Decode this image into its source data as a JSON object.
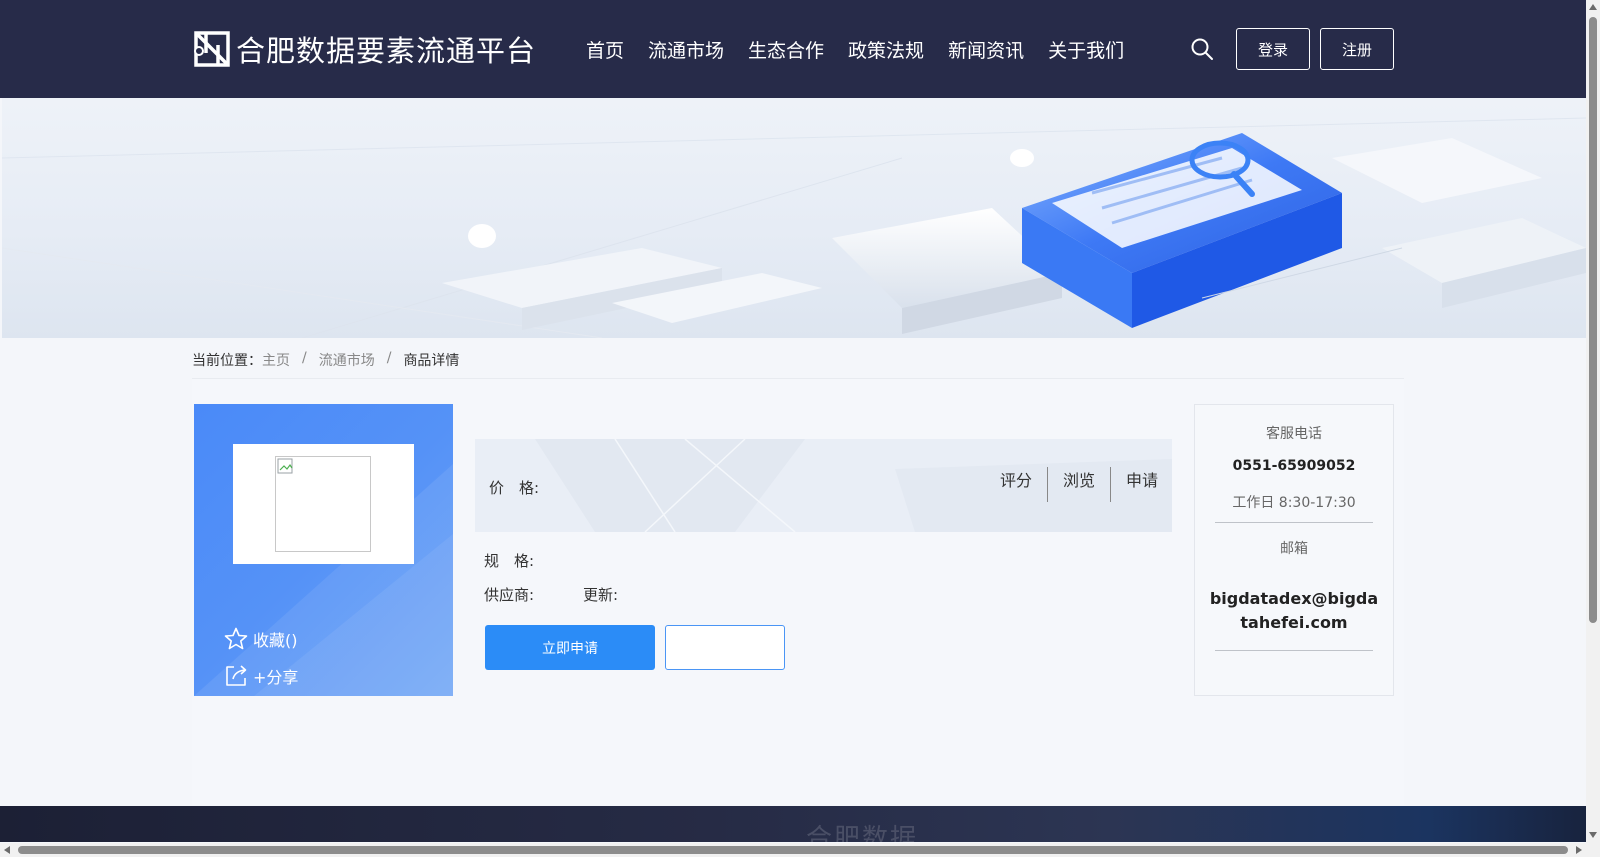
{
  "header": {
    "logo_text": "合肥数据要素流通平台",
    "nav": [
      "首页",
      "流通市场",
      "生态合作",
      "政策法规",
      "新闻资讯",
      "关于我们"
    ],
    "login_label": "登录",
    "register_label": "注册"
  },
  "breadcrumb": {
    "prefix": "当前位置：",
    "items": [
      "主页",
      "流通市场",
      "商品详情"
    ],
    "separator": "/"
  },
  "product": {
    "favorite_label": "收藏()",
    "share_label": "+分享",
    "price_label": "价　格:",
    "stats": [
      "评分",
      "浏览",
      "申请"
    ],
    "spec_label": "规　格:",
    "supplier_label": "供应商:",
    "update_label": "更新:",
    "apply_label": "立即申请"
  },
  "contact": {
    "title": "客服电话",
    "phone": "0551-65909052",
    "hours": "工作日 8:30-17:30",
    "mail_title": "邮箱",
    "mail": "bigdatadex@bigdatahefei.com"
  },
  "footer": {
    "ghost_text": "合肥数据"
  },
  "colors": {
    "header_bg": "#272b49",
    "primary": "#2b8cf7",
    "card_blue": "#4a8af8"
  }
}
